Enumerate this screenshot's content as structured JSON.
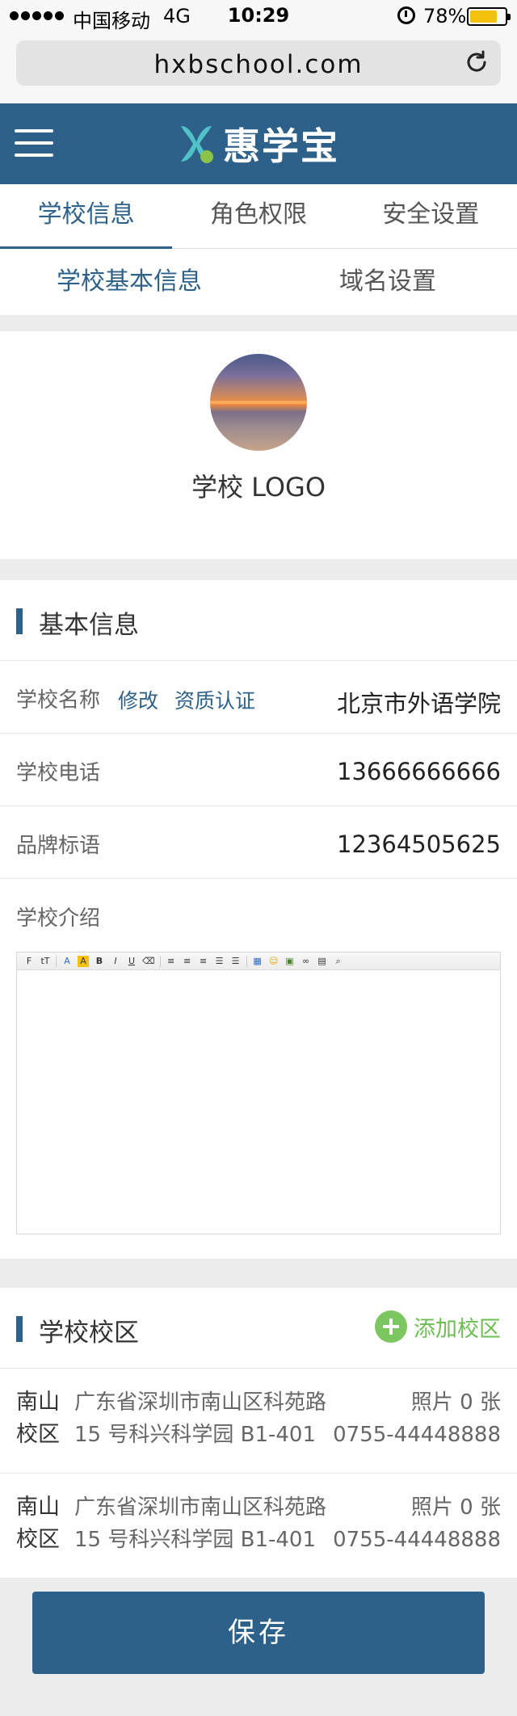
{
  "status_bar": {
    "carrier": "中国移动",
    "network": "4G",
    "time": "10:29",
    "battery_percent": "78%",
    "battery_level": 0.78
  },
  "browser": {
    "url": "hxbschool.com"
  },
  "header": {
    "brand_name": "惠学宝",
    "brand_color": "#2d6189"
  },
  "tabs": [
    {
      "label": "学校信息",
      "active": true
    },
    {
      "label": "角色权限",
      "active": false
    },
    {
      "label": "安全设置",
      "active": false
    }
  ],
  "subtabs": [
    {
      "label": "学校基本信息",
      "active": true
    },
    {
      "label": "域名设置",
      "active": false
    }
  ],
  "logo_section": {
    "label": "学校 LOGO"
  },
  "basic_info": {
    "title": "基本信息",
    "school_name": {
      "label": "学校名称",
      "edit_link": "修改",
      "verify_link": "资质认证",
      "value": "北京市外语学院"
    },
    "school_phone": {
      "label": "学校电话",
      "value": "13666666666"
    },
    "brand_slogan": {
      "label": "品牌标语",
      "value": "12364505625"
    },
    "intro": {
      "label": "学校介绍"
    }
  },
  "campus": {
    "title": "学校校区",
    "add_label": "添加校区",
    "add_color": "#7cc65f",
    "items": [
      {
        "name_line1": "南山",
        "name_line2": "校区",
        "address_line1": "广东省深圳市南山区科苑路",
        "address_line2": "15 号科兴科学园 B1-401",
        "photos": "照片 0 张",
        "phone": "0755-44448888"
      },
      {
        "name_line1": "南山",
        "name_line2": "校区",
        "address_line1": "广东省深圳市南山区科苑路",
        "address_line2": "15 号科兴科学园 B1-401",
        "photos": "照片 0 张",
        "phone": "0755-44448888"
      }
    ]
  },
  "save_label": "保存"
}
